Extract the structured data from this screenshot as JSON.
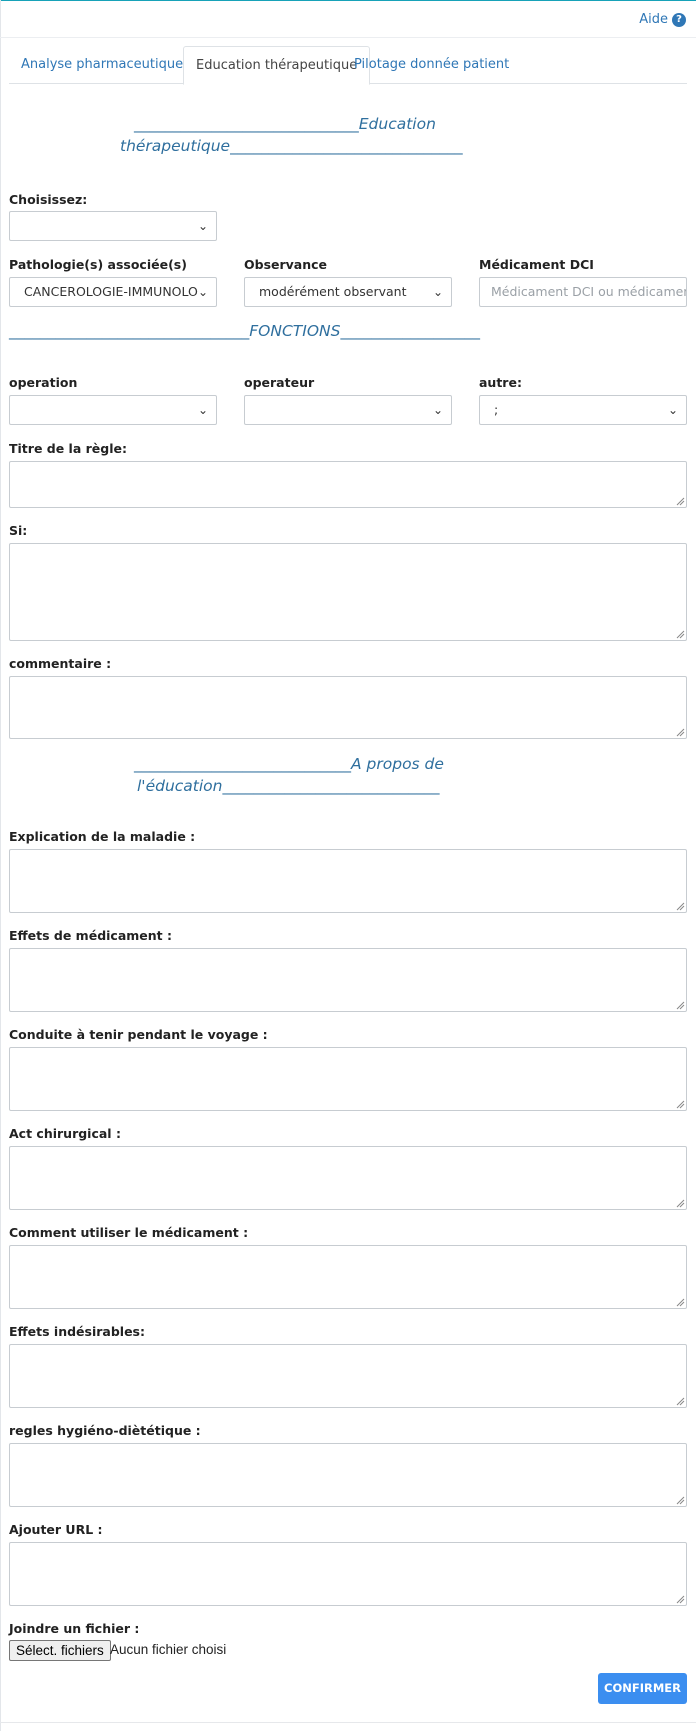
{
  "header": {
    "help_label": "Aide",
    "help_icon": "question-circle-icon"
  },
  "tabs": [
    {
      "label": "Analyse pharmaceutique",
      "active": false
    },
    {
      "label": "Education thérapeutique",
      "active": true
    },
    {
      "label": "Pilotage donnée patient",
      "active": false
    }
  ],
  "sections": {
    "education_line1": "_____________________________Education",
    "education_line2": "thérapeutique______________________________",
    "fonctions": "_______________________________FONCTIONS__________________",
    "apropos_line1": "____________________________A propos de",
    "apropos_line2": "l'éducation____________________________"
  },
  "form": {
    "choisissez": {
      "label": "Choisissez:",
      "value": ""
    },
    "pathologie": {
      "label": "Pathologie(s) associée(s)",
      "value": "CANCEROLOGIE-IMMUNOLO"
    },
    "observance": {
      "label": "Observance",
      "value": "modérément observant"
    },
    "medicament": {
      "label": "Médicament DCI",
      "placeholder": "Médicament DCI ou médicamen"
    },
    "operation": {
      "label": "operation",
      "value": ""
    },
    "operateur": {
      "label": "operateur",
      "value": ""
    },
    "autre": {
      "label": "autre:",
      "value": ";"
    },
    "titre": {
      "label": "Titre de la règle:"
    },
    "si": {
      "label": "Si:"
    },
    "commentaire": {
      "label": "commentaire :"
    },
    "explication": {
      "label": "Explication de la maladie :"
    },
    "effets_medicament": {
      "label": "Effets de médicament :"
    },
    "conduite": {
      "label": "Conduite à tenir pendant le voyage :"
    },
    "act": {
      "label": "Act chirurgical :"
    },
    "comment_utiliser": {
      "label": "Comment utiliser le médicament :"
    },
    "effets_indesirables": {
      "label": "Effets indésirables:"
    },
    "regles": {
      "label": "regles hygiéno-diètétique :"
    },
    "url": {
      "label": "Ajouter URL :"
    },
    "fichier": {
      "label": "Joindre un fichier :",
      "button": "Sélect. fichiers",
      "status": "Aucun fichier choisi"
    }
  },
  "actions": {
    "confirm_label": "CONFIRMER"
  },
  "colors": {
    "link": "#2f77b6",
    "section_title": "#2f6f9e",
    "confirm_button": "#3b8ef0",
    "border": "#c7ccd1"
  }
}
